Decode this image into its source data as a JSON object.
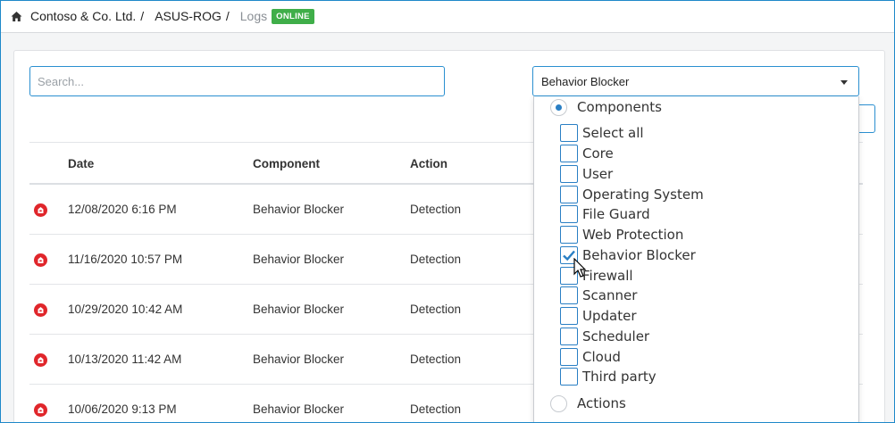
{
  "breadcrumb": {
    "home_icon": "home-icon",
    "org": "Contoso & Co. Ltd.",
    "device": "ASUS-ROG",
    "page": "Logs",
    "status": "ONLINE",
    "separator": "/"
  },
  "search": {
    "placeholder": "Search..."
  },
  "filter": {
    "selected": "Behavior Blocker",
    "groups": [
      {
        "label": "Components",
        "selected": true
      },
      {
        "label": "Actions",
        "selected": false
      }
    ],
    "options": [
      {
        "label": "Select all",
        "checked": false
      },
      {
        "label": "Core",
        "checked": false
      },
      {
        "label": "User",
        "checked": false
      },
      {
        "label": "Operating System",
        "checked": false
      },
      {
        "label": "File Guard",
        "checked": false
      },
      {
        "label": "Web Protection",
        "checked": false
      },
      {
        "label": "Behavior Blocker",
        "checked": true
      },
      {
        "label": "Firewall",
        "checked": false
      },
      {
        "label": "Scanner",
        "checked": false
      },
      {
        "label": "Updater",
        "checked": false
      },
      {
        "label": "Scheduler",
        "checked": false
      },
      {
        "label": "Cloud",
        "checked": false
      },
      {
        "label": "Third party",
        "checked": false
      }
    ]
  },
  "table": {
    "columns": [
      "Date",
      "Component",
      "Action"
    ],
    "rows": [
      {
        "date": "12/08/2020 6:16 PM",
        "component": "Behavior Blocker",
        "action": "Detection"
      },
      {
        "date": "11/16/2020 10:57 PM",
        "component": "Behavior Blocker",
        "action": "Detection"
      },
      {
        "date": "10/29/2020 10:42 AM",
        "component": "Behavior Blocker",
        "action": "Detection"
      },
      {
        "date": "10/13/2020 11:42 AM",
        "component": "Behavior Blocker",
        "action": "Detection"
      },
      {
        "date": "10/06/2020 9:13 PM",
        "component": "Behavior Blocker",
        "action": "Detection"
      }
    ]
  },
  "colors": {
    "accent": "#2a8fd0",
    "online": "#3fae49",
    "severity": "#e0262b"
  }
}
